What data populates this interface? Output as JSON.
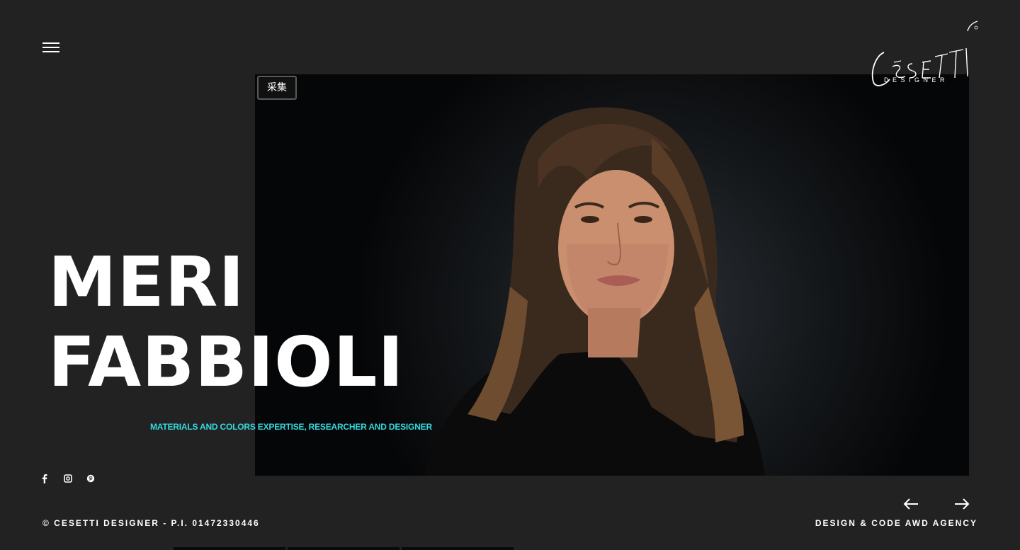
{
  "header": {
    "logo_text": "CESETTI",
    "logo_subtext": "DESIGNER"
  },
  "overlay": {
    "collect_label": "采集"
  },
  "hero": {
    "first_name": "MERI",
    "last_name": "FABBIOLI",
    "role": "MATERIALS AND COLORS EXPERTISE, RESEARCHER AND DESIGNER"
  },
  "social": [
    {
      "icon": "facebook-icon"
    },
    {
      "icon": "instagram-icon"
    },
    {
      "icon": "pinterest-icon"
    }
  ],
  "footer": {
    "copyright": "© CESETTI DESIGNER - P.I. 01472330446",
    "credit": "DESIGN & CODE AWD AGENCY"
  },
  "colors": {
    "background": "#222222",
    "accent": "#35d9e0",
    "text": "#ffffff"
  }
}
